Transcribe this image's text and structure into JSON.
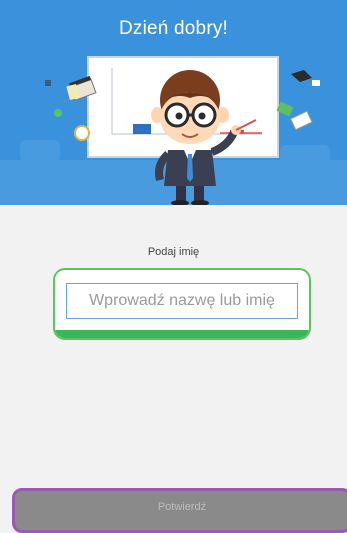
{
  "header": {
    "title": "Dzień dobry!",
    "background_color": "#3a92dc"
  },
  "form": {
    "label": "Podaj imię",
    "input_placeholder": "Wprowadź nazwę lub imię",
    "input_value": "",
    "frame_color": "#5cc45e"
  },
  "footer": {
    "confirm_label": "Potwierdź",
    "border_color": "#9b59b6"
  }
}
